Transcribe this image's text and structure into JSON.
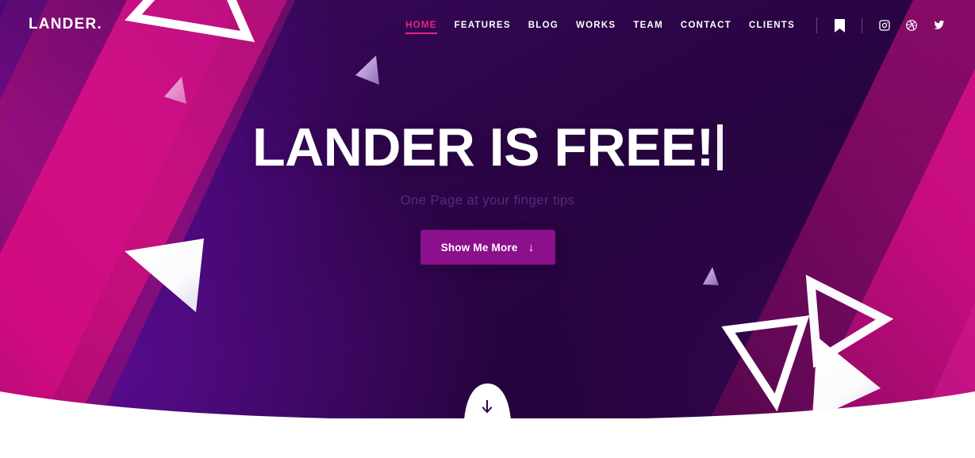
{
  "site": {
    "brand": "LANDER."
  },
  "nav": {
    "items": [
      {
        "label": "HOME",
        "active": true
      },
      {
        "label": "FEATURES",
        "active": false
      },
      {
        "label": "BLOG",
        "active": false
      },
      {
        "label": "WORKS",
        "active": false
      },
      {
        "label": "TEAM",
        "active": false
      },
      {
        "label": "CONTACT",
        "active": false
      },
      {
        "label": "CLIENTS",
        "active": false
      }
    ],
    "bookmark_icon": "bookmark-icon",
    "social": [
      {
        "name": "instagram-icon"
      },
      {
        "name": "dribbble-icon"
      },
      {
        "name": "twitter-icon"
      }
    ]
  },
  "hero": {
    "title": "LANDER IS FREE!",
    "typing_caret": true,
    "subtitle": "One Page at your finger tips",
    "cta_label": "Show Me More",
    "cta_arrow": "↓",
    "scroll_arrow": "↓"
  },
  "colors": {
    "accent_pink": "#e8247f",
    "band_magenta": "#cc0c7d",
    "bg_dark_purple": "#2a0340",
    "bg_purple": "#57098f",
    "button_purple": "#8c0f8c",
    "subtitle_purple": "#5a2a84",
    "white": "#ffffff"
  }
}
